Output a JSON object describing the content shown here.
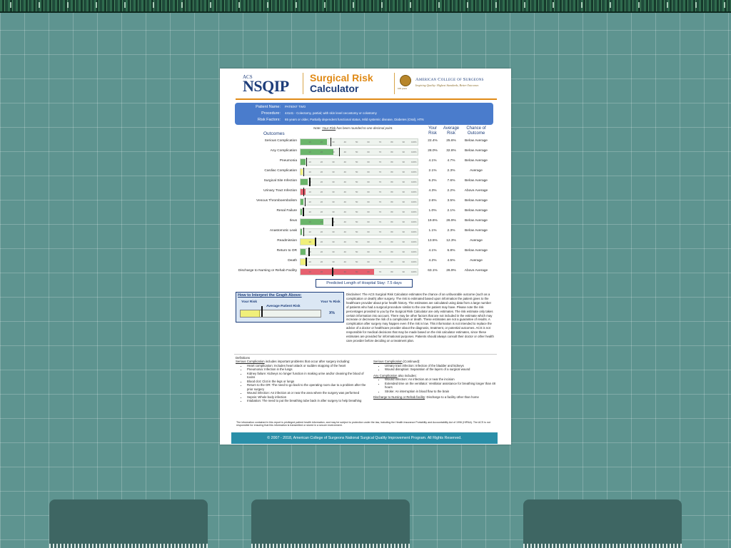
{
  "header": {
    "logo_small": "ACS",
    "logo_main": "NSQIP",
    "title_line1": "Surgical Risk",
    "title_line2": "Calculator",
    "seal_caption": "100 years",
    "college_name": "American College of Surgeons",
    "motto": "Inspiring Quality: Highest Standards, Better Outcomes",
    "seal_icon": "acs-seal-icon"
  },
  "patient": {
    "name_label": "Patient Name:",
    "name_value": "PATIENT TWO",
    "procedure_label": "Procedure:",
    "procedure_value": "44141 - Colectomy, partial; with skin level cecostomy or colostomy",
    "risk_label": "Risk Factors:",
    "risk_value": "65 years or older, Partially dependent functional status, Mild systemic disease, Diabetes (Oral), HTN"
  },
  "note": {
    "prefix": "Note: ",
    "emphasis": "Your Risk",
    "suffix": " has been rounded to one decimal point."
  },
  "columns": {
    "outcomes": "Outcomes",
    "your_risk_1": "Your",
    "your_risk_2": "Risk",
    "avg_risk_1": "Average",
    "avg_risk_2": "Risk",
    "chance_1": "Chance of",
    "chance_2": "Outcome"
  },
  "colors": {
    "below": "#6ab56a",
    "average": "#f0ef7a",
    "above": "#e6606e",
    "brand_blue": "#1d3d7a",
    "brand_orange": "#e08a16"
  },
  "ticks": [
    "10",
    "20",
    "30",
    "40",
    "50",
    "60",
    "70",
    "80",
    "90",
    "100%"
  ],
  "outcomes": [
    {
      "name": "Serious Complication",
      "your": "22.4%",
      "avg": "25.6%",
      "chance": "Below Average",
      "your_val": 22.4,
      "avg_val": 25.6,
      "level": "below"
    },
    {
      "name": "Any Complication",
      "your": "28.0%",
      "avg": "32.8%",
      "chance": "Below Average",
      "your_val": 28.0,
      "avg_val": 32.8,
      "level": "below"
    },
    {
      "name": "Pneumonia",
      "your": "4.1%",
      "avg": "4.7%",
      "chance": "Below Average",
      "your_val": 4.1,
      "avg_val": 4.7,
      "level": "below"
    },
    {
      "name": "Cardiac Complication",
      "your": "2.1%",
      "avg": "2.3%",
      "chance": "Average",
      "your_val": 2.1,
      "avg_val": 2.3,
      "level": "average"
    },
    {
      "name": "Surgical Site Infection",
      "your": "6.2%",
      "avg": "7.6%",
      "chance": "Below Average",
      "your_val": 6.2,
      "avg_val": 7.6,
      "level": "below"
    },
    {
      "name": "Urinary Tract Infection",
      "your": "4.3%",
      "avg": "2.2%",
      "chance": "Above Average",
      "your_val": 4.3,
      "avg_val": 2.2,
      "level": "above"
    },
    {
      "name": "Venous Thromboembolism",
      "your": "2.6%",
      "avg": "3.5%",
      "chance": "Below Average",
      "your_val": 2.6,
      "avg_val": 3.5,
      "level": "below"
    },
    {
      "name": "Renal Failure",
      "your": "1.0%",
      "avg": "2.1%",
      "chance": "Below Average",
      "your_val": 1.0,
      "avg_val": 2.1,
      "level": "below"
    },
    {
      "name": "Ileus",
      "your": "19.6%",
      "avg": "26.9%",
      "chance": "Below Average",
      "your_val": 19.6,
      "avg_val": 26.9,
      "level": "below"
    },
    {
      "name": "Anastomotic Leak",
      "your": "1.1%",
      "avg": "2.3%",
      "chance": "Below Average",
      "your_val": 1.1,
      "avg_val": 2.3,
      "level": "below"
    },
    {
      "name": "Readmission",
      "your": "13.5%",
      "avg": "12.3%",
      "chance": "Average",
      "your_val": 13.5,
      "avg_val": 12.3,
      "level": "average"
    },
    {
      "name": "Return to OR",
      "your": "4.1%",
      "avg": "6.8%",
      "chance": "Below Average",
      "your_val": 4.1,
      "avg_val": 6.8,
      "level": "below"
    },
    {
      "name": "Death",
      "your": "4.2%",
      "avg": "4.5%",
      "chance": "Average",
      "your_val": 4.2,
      "avg_val": 4.5,
      "level": "average"
    },
    {
      "name": "Discharge to Nursing or Rehab Facility",
      "your": "63.1%",
      "avg": "26.9%",
      "chance": "Above Average",
      "your_val": 63.1,
      "avg_val": 26.9,
      "level": "above"
    }
  ],
  "los": "Predicted Length of Hospital Stay: 7.5 days",
  "howto": {
    "title": "How to Interpret the Graph Above:",
    "your_risk": "Your Risk",
    "avg_risk": "Average Patient Risk",
    "your_pct": "Your % Risk",
    "x_pct": "X%"
  },
  "disclaimer": "Disclaimer: The ACS Surgical Risk Calculator estimates the chance of an unfavorable outcome (such as a complication or death) after surgery. The risk is estimated based upon information the patient gives to the healthcare provider about prior health history. The estimates are calculated using data from a large number of patients who had a surgical procedure similar to the one the patient may have. Please note the risk percentages provided to you by the Surgical Risk Calculator are only estimates. The risk estimate only takes certain information into account. There may be other factors that are not included in the estimate which may increase or decrease the risk of a complication or death. These estimates are not a guarantee of results. A complication after surgery may happen even if the risk is low. This information is not intended to replace the advice of a doctor or healthcare provider about the diagnosis, treatment, or potential outcomes. ACS is not responsible for medical decisions that may be made based on the risk calculator estimates, since these estimates are provided for informational purposes. Patients should always consult their doctor or other health care provider before deciding on a treatment plan.",
  "definitions": {
    "heading": "Definitions",
    "serious_head": "Serious Complication",
    "serious_intro": " includes important problems that occur after surgery including:",
    "serious_items": [
      "Heart complication: Includes heart attack or sudden stopping of the heart",
      "Pneumonia: Infection in the lungs",
      "Kidney failure: Kidneys no longer function in making urine and/or cleaning the blood of toxins",
      "Blood clot: Clot in the legs or lungs",
      "Return to the OR: The need to go back to the operating room due to a problem after the prior surgery",
      "Wound infection: An infection at or near the area where the surgery was performed",
      "Sepsis: Whole body infection",
      "Intubation: The need to put the breathing tube back in after surgery to help breathing"
    ],
    "serious_cont_head": "Serious Complication",
    "serious_cont_suffix": " (Continued):",
    "serious_cont_items": [
      "Urinary tract infection: Infection of the bladder and kidneys",
      "Wound disruption: Separation of the layers of a surgical wound"
    ],
    "any_head": "Any Complication",
    "any_intro": " also includes:",
    "any_items": [
      "Wound infection: An infection at or near the incision",
      "Extended time on the ventilator: Ventilator assistance for breathing longer than 48 hours",
      "Stroke: An interruption in blood flow to the brain"
    ],
    "discharge_head": "Discharge to Nursing or Rehab facility",
    "discharge_text": ": Discharge to a facility other than home"
  },
  "legal": "The information contained in this report is privileged patient health information, and may be subject to protection under the law, including the Health Insurance Portability and Accountability Act of 1996 (HIPAA). The ACS is not responsible for ensuring that this information is transmitted or stored in a secure environment.",
  "copyright": "© 2007 - 2018, American College of Surgeons National Surgical Quality Improvement Program. All Rights Reserved."
}
